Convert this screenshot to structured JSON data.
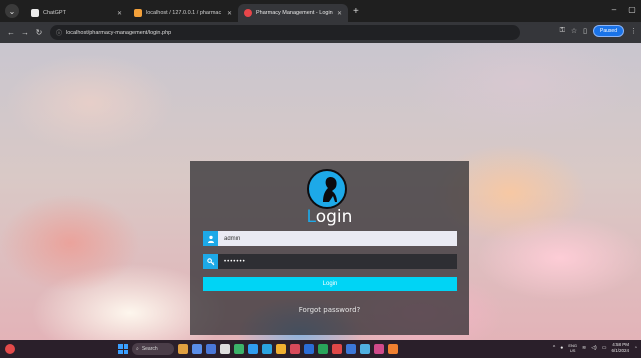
{
  "browser": {
    "tabs": [
      {
        "title": "ChatGPT",
        "icon": "chatgpt-icon",
        "active": false
      },
      {
        "title": "localhost / 127.0.0.1 / pharmac",
        "icon": "phpmyadmin-icon",
        "active": false
      },
      {
        "title": "Pharmacy Management - Login",
        "icon": "pharmacy-favicon",
        "active": true
      }
    ],
    "new_tab": "+",
    "window_controls": [
      "–",
      "▢"
    ],
    "address": "localhost/pharmacy-management/login.php",
    "profile_label": "Paused"
  },
  "login": {
    "title_first_letter": "L",
    "title_rest": "ogin",
    "username_value": "admin",
    "password_value": "•••••••",
    "button_label": "Login",
    "forgot_label": "Forgot password?"
  },
  "taskbar": {
    "search_label": "Search",
    "lang_top": "ENG",
    "lang_bottom": "US",
    "time": "4:58 PM",
    "date": "6/1/2024"
  },
  "colors": {
    "accent": "#1da9e8",
    "button": "#00d4f5"
  }
}
